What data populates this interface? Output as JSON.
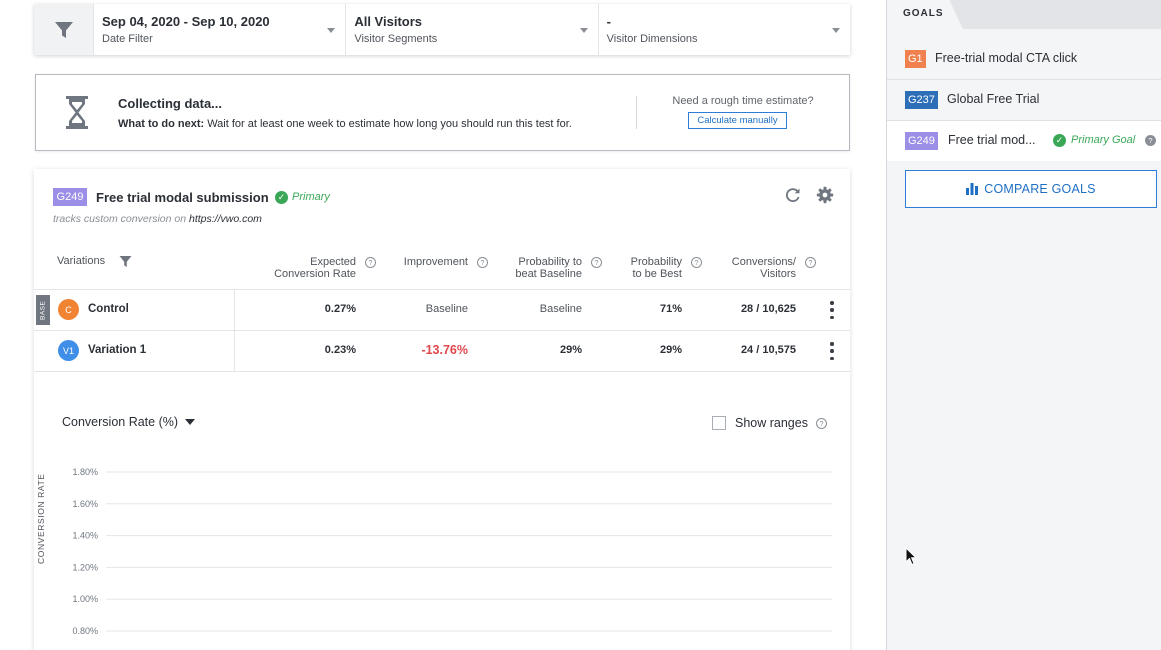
{
  "filters": [
    {
      "value": "Sep 04, 2020 - Sep 10, 2020",
      "label": "Date Filter"
    },
    {
      "value": "All Visitors",
      "label": "Visitor Segments"
    },
    {
      "value": "-",
      "label": "Visitor Dimensions"
    }
  ],
  "banner": {
    "title": "Collecting data...",
    "next_label": "What to do next:",
    "next_text": " Wait for at least one week to estimate how long you should run this test for.",
    "question": "Need a rough time estimate?",
    "button": "Calculate manually"
  },
  "card": {
    "goal_id": "G249",
    "title": "Free trial modal submission",
    "primary": "Primary",
    "tracks_text": "tracks custom conversion on ",
    "tracks_url": "https://vwo.com",
    "help_glyph": "?"
  },
  "table": {
    "headers": {
      "variations": "Variations",
      "expected_1": "Expected",
      "expected_2": "Conversion Rate",
      "improvement": "Improvement",
      "prob_base_1": "Probability to",
      "prob_base_2": "beat Baseline",
      "prob_best_1": "Probability",
      "prob_best_2": "to be Best",
      "conv_1": "Conversions/",
      "conv_2": "Visitors"
    },
    "base_tag": "BASE",
    "rows": [
      {
        "avatar": "C",
        "name": "Control",
        "rate": "0.27%",
        "improvement": "Baseline",
        "prob_base": "Baseline",
        "prob_best": "71%",
        "conversions": "28 / 10,625"
      },
      {
        "avatar": "V1",
        "name": "Variation 1",
        "rate": "0.23%",
        "improvement": "-13.76%",
        "prob_base": "29%",
        "prob_best": "29%",
        "conversions": "24 / 10,575"
      }
    ]
  },
  "chart_controls": {
    "metric": "Conversion Rate (%)",
    "show_ranges": "Show ranges"
  },
  "chart_data": {
    "type": "line",
    "title": "",
    "ylabel": "CONVERSION RATE",
    "yticks": [
      "1.80%",
      "1.60%",
      "1.40%",
      "1.20%",
      "1.00%",
      "0.80%"
    ],
    "ylim": [
      0.8,
      1.8
    ],
    "series": []
  },
  "right_panel": {
    "tab": "GOALS",
    "goals": [
      {
        "id": "G1",
        "name": "Free-trial modal CTA click",
        "color": "#f0804d"
      },
      {
        "id": "G237",
        "name": "Global Free Trial",
        "color": "#2c6eb8"
      },
      {
        "id": "G249",
        "name": "Free trial mod...",
        "color": "#9b8ee6",
        "tag": "Primary Goal"
      }
    ],
    "compare_button": "COMPARE GOALS"
  },
  "colors": {
    "accent_blue": "#2e7ed8",
    "success_green": "#3aa757",
    "negative_red": "#e0474c",
    "control_orange": "#f08433",
    "variation_blue": "#3f8fe8"
  }
}
